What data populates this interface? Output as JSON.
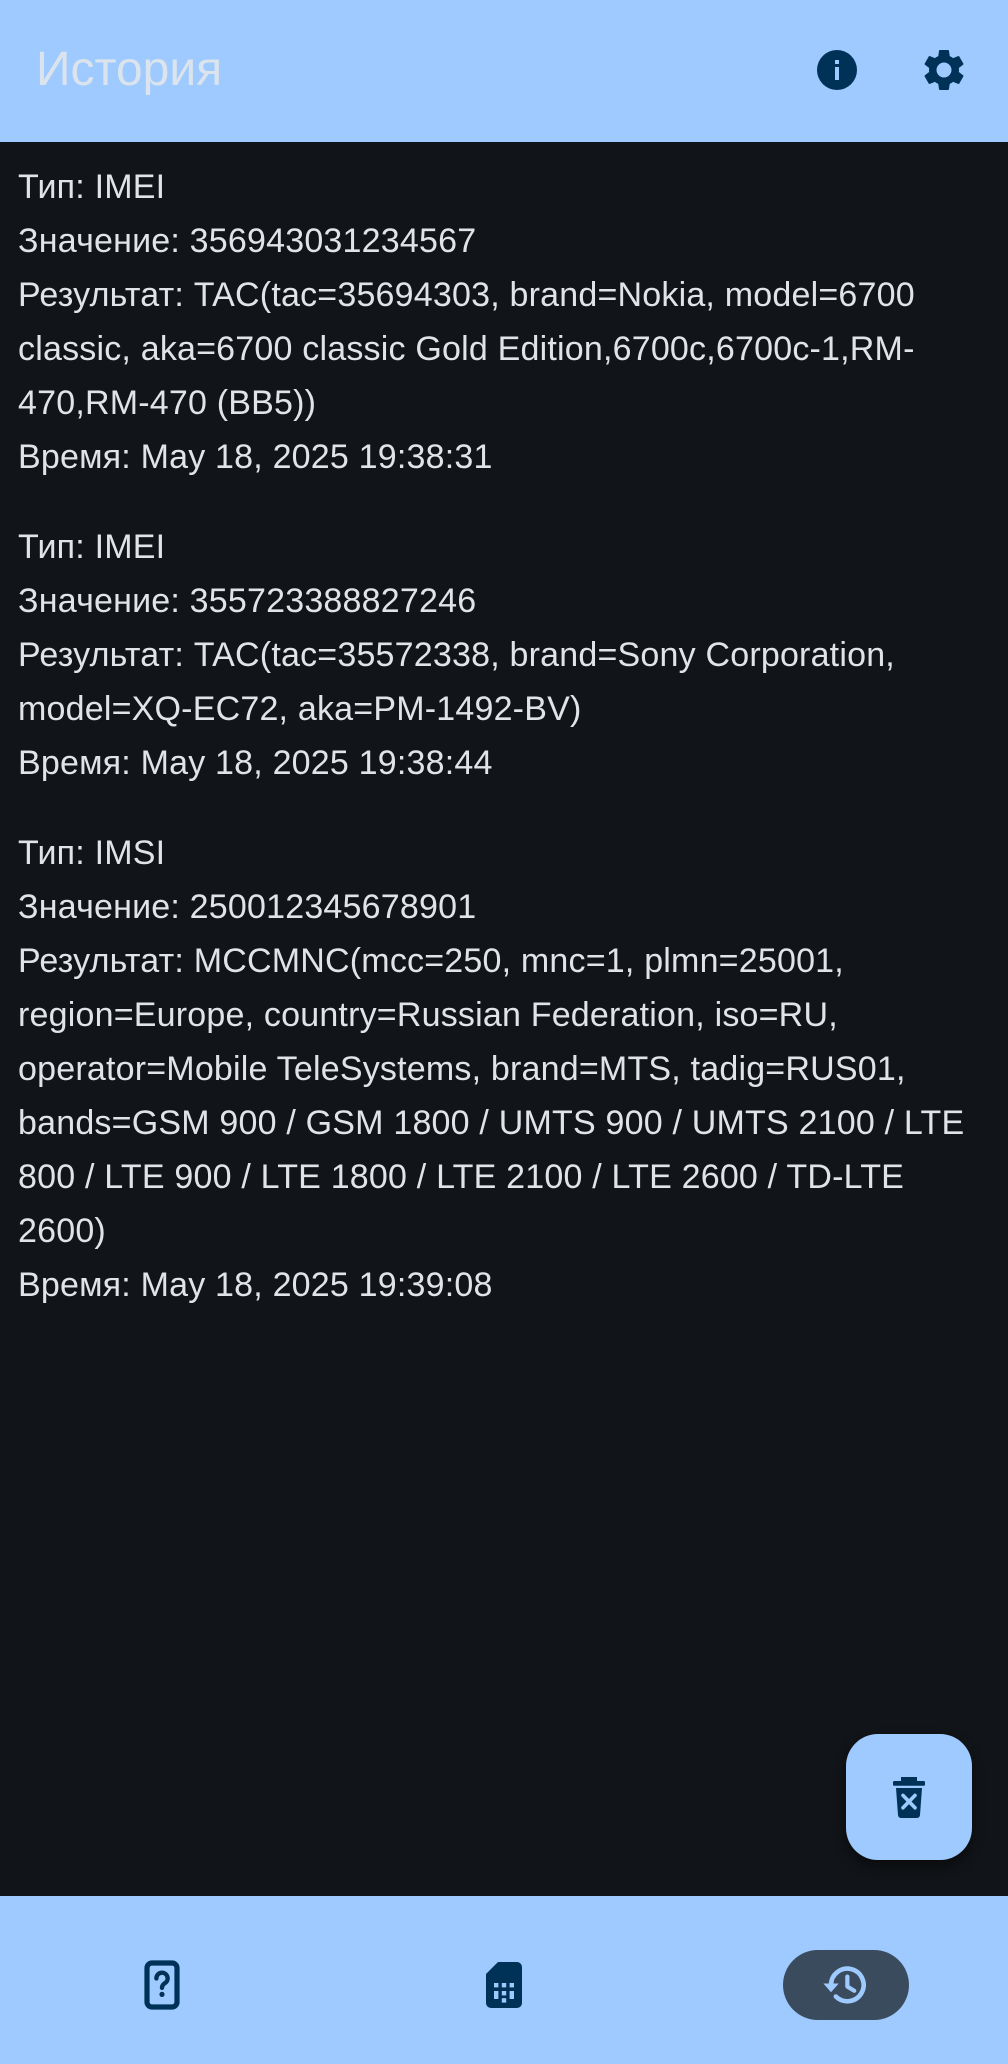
{
  "app_bar": {
    "title": "История",
    "actions": [
      {
        "icon": "info-icon"
      },
      {
        "icon": "gear-icon"
      }
    ]
  },
  "history": [
    {
      "type": "Тип: IMEI",
      "value": "Значение: 356943031234567",
      "result": "Результат: TAC(tac=35694303, brand=Nokia, model=6700 classic, aka=6700 classic Gold Edition,6700c,6700c-1,RM-470,RM-470 (BB5))",
      "time": "Время: May 18, 2025 19:38:31"
    },
    {
      "type": "Тип: IMEI",
      "value": "Значение: 355723388827246",
      "result": "Результат: TAC(tac=35572338, brand=Sony Corporation, model=XQ-EC72, aka=PM-1492-BV)",
      "time": "Время: May 18, 2025 19:38:44"
    },
    {
      "type": "Тип: IMSI",
      "value": "Значение: 250012345678901",
      "result": "Результат: MCCMNC(mcc=250, mnc=1, plmn=25001, region=Europe, country=Russian Federation, iso=RU, operator=Mobile TeleSystems, brand=MTS, tadig=RUS01, bands=GSM 900 / GSM 1800 / UMTS 900 / UMTS 2100 / LTE 800 / LTE 900 / LTE 1800 / LTE 2100 / LTE 2600 / TD-LTE 2600)",
      "time": "Время: May 18, 2025 19:39:08"
    }
  ],
  "fab": {
    "icon": "delete-history-icon"
  },
  "bottom_nav": {
    "items": [
      {
        "icon": "phone-question-icon",
        "selected": false
      },
      {
        "icon": "sim-card-icon",
        "selected": false
      },
      {
        "icon": "history-icon",
        "selected": true
      }
    ]
  },
  "colors": {
    "bar": "#9ecaff",
    "background": "#111418",
    "text": "#e1e3e8",
    "icon": "#003258",
    "selected_indicator": "#3b4b5e"
  }
}
